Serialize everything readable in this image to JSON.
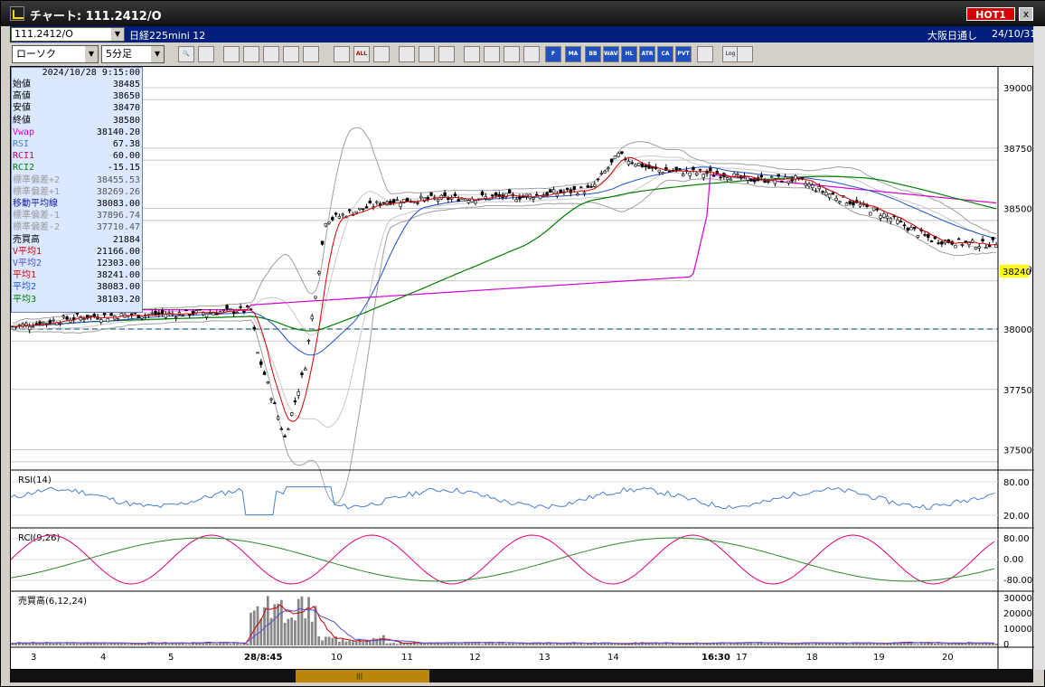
{
  "window": {
    "title": "チャート: 111.2412/O",
    "hot_label": "HOT1",
    "close_label": "x"
  },
  "infobar": {
    "symbol_code": "111.2412/O",
    "symbol_name": "日経225mini 12",
    "session": "大阪日通し",
    "date": "24/10/31"
  },
  "toolbar": {
    "chart_type": "ローソク",
    "interval": "5分足",
    "buttons": [
      {
        "name": "zoom",
        "label": "🔍"
      },
      {
        "name": "draw",
        "label": ""
      },
      {
        "name": "pen",
        "label": ""
      },
      {
        "name": "arrow",
        "label": ""
      },
      {
        "name": "copy",
        "label": ""
      },
      {
        "name": "trash",
        "label": ""
      },
      {
        "name": "mark1",
        "label": ""
      },
      {
        "name": "mark2",
        "label": ""
      },
      {
        "name": "all",
        "label": "ALL"
      },
      {
        "name": "cube",
        "label": ""
      },
      {
        "name": "brush",
        "label": ""
      },
      {
        "name": "color",
        "label": ""
      },
      {
        "name": "stamp",
        "label": ""
      },
      {
        "name": "q",
        "label": ""
      },
      {
        "name": "chart1",
        "label": ""
      },
      {
        "name": "chart2",
        "label": ""
      },
      {
        "name": "chart3",
        "label": ""
      },
      {
        "name": "f",
        "label": "F"
      },
      {
        "name": "ma",
        "label": "MA"
      },
      {
        "name": "bb",
        "label": "BB"
      },
      {
        "name": "wave",
        "label": "WAVE"
      },
      {
        "name": "hl",
        "label": "HL"
      },
      {
        "name": "atr",
        "label": "ATR"
      },
      {
        "name": "ca",
        "label": "CA"
      },
      {
        "name": "pvt",
        "label": "PVT"
      },
      {
        "name": "win",
        "label": ""
      },
      {
        "name": "log",
        "label": "Log"
      },
      {
        "name": "exp",
        "label": ""
      }
    ]
  },
  "info_panel": {
    "timestamp": "2024/10/28 9:15:00",
    "rows": [
      {
        "label": "始値",
        "value": "38485",
        "color": "#000000"
      },
      {
        "label": "高値",
        "value": "38650",
        "color": "#000000"
      },
      {
        "label": "安値",
        "value": "38470",
        "color": "#000000"
      },
      {
        "label": "終値",
        "value": "38580",
        "color": "#000000"
      },
      {
        "label": "Vwap",
        "value": "38140.20",
        "color": "#d000d0"
      },
      {
        "label": "RSI",
        "value": "67.38",
        "color": "#4a7fd0"
      },
      {
        "label": "RCI1",
        "value": "60.00",
        "color": "#d00060"
      },
      {
        "label": "RCI2",
        "value": "-15.15",
        "color": "#008000"
      },
      {
        "label": "標準偏差+2",
        "value": "38455.53",
        "color": "#999999"
      },
      {
        "label": "標準偏差+1",
        "value": "38269.26",
        "color": "#999999"
      },
      {
        "label": "移動平均線",
        "value": "38083.00",
        "color": "#1a1aa0"
      },
      {
        "label": "標準偏差-1",
        "value": "37896.74",
        "color": "#999999"
      },
      {
        "label": "標準偏差-2",
        "value": "37710.47",
        "color": "#999999"
      },
      {
        "label": "売買高",
        "value": "21884",
        "color": "#000000"
      },
      {
        "label": "V平均1",
        "value": "21166.00",
        "color": "#d00000"
      },
      {
        "label": "V平均2",
        "value": "12303.00",
        "color": "#5050d0"
      },
      {
        "label": "平均1",
        "value": "38241.00",
        "color": "#d00000"
      },
      {
        "label": "平均2",
        "value": "38083.00",
        "color": "#2050d0"
      },
      {
        "label": "平均3",
        "value": "38103.20",
        "color": "#008000"
      }
    ]
  },
  "price_axis": {
    "labels": [
      "39000",
      "38750",
      "38500",
      "38250",
      "38000",
      "37750",
      "37500"
    ],
    "current_price": "38240",
    "current_color": "#ffff00"
  },
  "panels": {
    "rsi": {
      "title": "RSI(14)",
      "labels": [
        "80.00",
        "20.00"
      ]
    },
    "rci": {
      "title": "RCI(9,26)",
      "labels": [
        "80.00",
        "0.00",
        "-80.00"
      ]
    },
    "volume": {
      "title": "売買高(6,12,24)",
      "labels": [
        "30000",
        "20000",
        "10000",
        "0"
      ]
    }
  },
  "time_axis": {
    "labels": [
      "3",
      "4",
      "5",
      "28/8:45",
      "10",
      "11",
      "12",
      "13",
      "14",
      "16:30",
      "17",
      "18",
      "19",
      "20"
    ]
  },
  "colors": {
    "candle_up": "#ffffff",
    "candle_down": "#000000",
    "ma1": "#d00000",
    "ma2": "#2050d0",
    "ma3": "#008000",
    "vwap": "#d000d0",
    "bollinger": "#a0a0a0",
    "rsi": "#4a7fd0",
    "rci1": "#e0007a",
    "rci2": "#2a8a2a"
  }
}
